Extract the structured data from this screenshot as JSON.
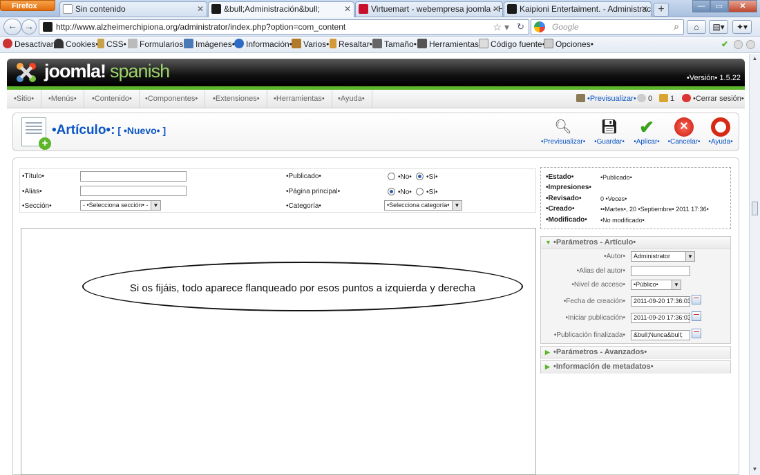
{
  "browser": {
    "menu_button": "Firefox",
    "tabs": [
      {
        "label": "Sin contenido",
        "active": false
      },
      {
        "label": "&bull;Administración&bull;",
        "active": true
      },
      {
        "label": "Virtuemart - webempresa joomla - H...",
        "active": false
      },
      {
        "label": "Kaipioni Entertaiment. - Administraci...",
        "active": false
      }
    ],
    "new_tab": "+",
    "url": "http://www.alzheimerchipiona.org/administrator/index.php?option=com_content",
    "search_placeholder": "Google"
  },
  "devbar": {
    "items": [
      "Desactivar•",
      "Cookies•",
      "CSS•",
      "Formularios•",
      "Imágenes•",
      "Información•",
      "Varios•",
      "Resaltar•",
      "Tamaño•",
      "Herramientas•",
      "Código fuente•",
      "Opciones•"
    ]
  },
  "joomla": {
    "logo_text": "joomla!",
    "logo_sub": "spanish",
    "version": "•Versión• 1.5.22",
    "menu": [
      "•Sitio•",
      "•Menús•",
      "•Contenido•",
      "•Componentes•",
      "•Extensiones•",
      "•Herramientas•",
      "•Ayuda•"
    ],
    "preview_link": "•Previsualizar•",
    "messages_count": "0",
    "users_count": "1",
    "logout": "•Cerrar sesión•"
  },
  "toolbar": {
    "title": "•Artículo•:",
    "subtitle": "[ •Nuevo• ]",
    "buttons": [
      {
        "label": "•Previsualizar•",
        "icon": "magnifier-icon"
      },
      {
        "label": "•Guardar•",
        "icon": "floppy-disk-icon"
      },
      {
        "label": "•Aplicar•",
        "icon": "checkmark-icon"
      },
      {
        "label": "•Cancelar•",
        "icon": "cancel-icon"
      },
      {
        "label": "•Ayuda•",
        "icon": "lifebuoy-icon"
      }
    ]
  },
  "form": {
    "title_label": "•Título•",
    "title_value": "",
    "alias_label": "•Alias•",
    "alias_value": "",
    "section_label": "•Sección•",
    "section_value": "- •Selecciona sección• -",
    "published_label": "•Publicado•",
    "frontpage_label": "•Página principal•",
    "no_label": "•No•",
    "yes_label": "•Sí•",
    "category_label": "•Categoría•",
    "category_value": "•Selecciona categoría•"
  },
  "status": {
    "state_label": "•Estado•",
    "state_value": "•Publicado•",
    "hits_label": "•Impresiones•",
    "hits_value": "",
    "revised_label": "•Revisado•",
    "revised_value": "0 •Veces•",
    "created_label": "•Creado•",
    "created_value": "••Martes•, 20 •Septiembre• 2011 17:36•",
    "modified_label": "•Modificado•",
    "modified_value": "•No modificado•"
  },
  "params": {
    "article_header": "•Parámetros - Artículo•",
    "author_label": "•Autor•",
    "author_value": "Administrator",
    "author_alias_label": "•Alias del autor•",
    "author_alias_value": "",
    "access_label": "•Nivel de acceso•",
    "access_value": "•Público•",
    "created_date_label": "•Fecha de creación•",
    "created_date_value": "2011-09-20 17:36:03",
    "publish_up_label": "•Iniciar publicación•",
    "publish_up_value": "2011-09-20 17:36:03",
    "publish_down_label": "•Publicación finalizada•",
    "publish_down_value": "&bull;Nunca&bull;",
    "advanced_header": "•Parámetros - Avanzados•",
    "metadata_header": "•Información de metadatos•"
  },
  "annotation": {
    "text": "Si os fijáis, todo aparece flanqueado por esos puntos a izquierda y derecha"
  }
}
